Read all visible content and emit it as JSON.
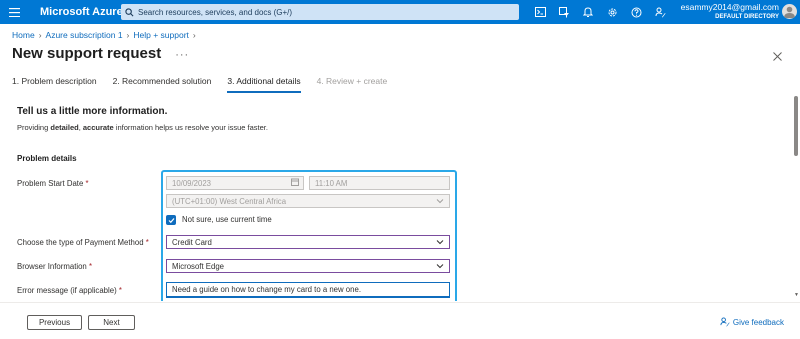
{
  "topbar": {
    "brand": "Microsoft Azure",
    "search_placeholder": "Search resources, services, and docs (G+/)",
    "account_email": "esammy2014@gmail.com",
    "account_directory": "DEFAULT DIRECTORY",
    "icons": [
      "cloud-shell-icon",
      "directory-filter-icon",
      "notifications-icon",
      "settings-icon",
      "help-icon",
      "feedback-icon"
    ]
  },
  "breadcrumb": [
    "Home",
    "Azure subscription 1",
    "Help + support"
  ],
  "page": {
    "title": "New support request",
    "more": "···"
  },
  "steps": [
    {
      "label": "1. Problem description"
    },
    {
      "label": "2. Recommended solution"
    },
    {
      "label": "3. Additional details"
    },
    {
      "label": "4. Review + create"
    }
  ],
  "content": {
    "heading": "Tell us a little more information.",
    "intro_pre": "Providing ",
    "intro_b1": "detailed",
    "intro_mid": ", ",
    "intro_b2": "accurate",
    "intro_post": " information helps us resolve your issue faster.",
    "section": "Problem details",
    "fields": {
      "start_date_label": "Problem Start Date",
      "start_date_value": "10/09/2023",
      "start_time_value": "11:10 AM",
      "timezone_value": "(UTC+01:00) West Central Africa",
      "not_sure_label": "Not sure, use current time",
      "payment_label": "Choose the type of Payment Method",
      "payment_value": "Credit Card",
      "browser_label": "Browser Information",
      "browser_value": "Microsoft Edge",
      "error_label": "Error message (if applicable)",
      "error_value": "Need a guide on how to change my card to a new one.",
      "required_mark": "*"
    }
  },
  "footer": {
    "previous": "Previous",
    "next": "Next",
    "feedback": "Give feedback"
  },
  "colors": {
    "brand": "#0078d4",
    "link": "#0f6cbd",
    "highlight": "#2aa8e8"
  }
}
